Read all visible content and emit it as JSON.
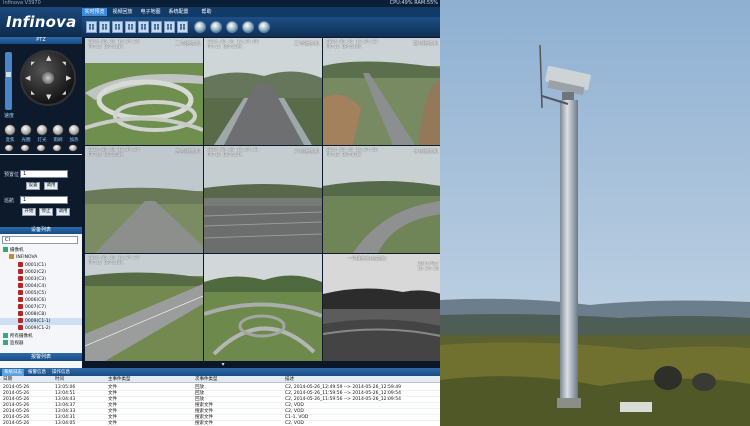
{
  "app": {
    "logo_text": "Infinova",
    "window_title": "Infinova V3970",
    "sysinfo": "CPU:49% RAM:55%",
    "menu_tabs": [
      "实时预览",
      "视频回放",
      "电子地图",
      "系统配置",
      "帮助"
    ],
    "ptz_title": "PTZ",
    "speed_label": "速度",
    "ptz_labels_row1": [
      "变焦",
      "光圈",
      "灯光",
      "雨刷",
      "加热"
    ],
    "ptz_labels_row2": [
      "聚焦",
      "",
      "",
      "",
      ""
    ],
    "preset_label": "预置位",
    "preset_value": "1",
    "preset_buttons": [
      "设置",
      "调用"
    ],
    "cruise_label": "巡航",
    "cruise_value": "1",
    "cruise_buttons": [
      "开始",
      "停止",
      "调用"
    ],
    "device_list_title": "设备列表",
    "device_combo": "CI",
    "device_tree": {
      "root": "摄像机",
      "nvr": "INFINOVA",
      "cameras": [
        "0001(C1)",
        "0002(C2)",
        "0003(C3)",
        "0004(C4)",
        "0005(C5)",
        "0006(C6)",
        "0007(C7)",
        "0008(C8)",
        "0009(C1-1)",
        "0009(C1-2)"
      ],
      "group1": "所有摄像机",
      "group2": "监视器"
    },
    "alarm_list_title": "报警列表"
  },
  "video": {
    "cells": [
      {
        "name": "二号摄像机",
        "time": "2014-05-26 16:34:22",
        "rate": "FR=15 BR=511K"
      },
      {
        "name": "三号摄像机",
        "time": "2014-05-26 16:34:08",
        "rate": "FR=15 BR=529K"
      },
      {
        "name": "四号摄像机",
        "time": "2014-05-26 16:34:23",
        "rate": "FR=15 BR=514K"
      },
      {
        "name": "五号摄像机",
        "time": "2014-05-26 16:34:24",
        "rate": "FR=15 BR=550K"
      },
      {
        "name": "六号摄像机",
        "time": "2014-05-26 16:34:11",
        "rate": "FR=15 BR=514K"
      },
      {
        "name": "七号摄像机",
        "time": "2014-05-26 16:34:26",
        "rate": "FR=15 BR=451K"
      },
      {
        "name": "",
        "time": "2014-05-26 16:34:22",
        "rate": "FR=15 BR=518K"
      },
      {
        "name": "",
        "time": "",
        "rate": ""
      },
      {
        "name": "一号摄像机(热成像)",
        "time": "2014/05/\n16:34:25",
        "rate": ""
      }
    ]
  },
  "log": {
    "tabs": [
      "系统日志",
      "报警信息",
      "操作信息"
    ],
    "headers": [
      "日期",
      "时间",
      "主事件类型",
      "次事件类型",
      "描述"
    ],
    "rows": [
      [
        "2014-05-26",
        "13:05:06",
        "文件",
        "回放",
        "C2, 2014-05-26_12:49:59 --> 2014-05-26_12:59:49"
      ],
      [
        "2014-05-26",
        "13:04:51",
        "文件",
        "回放",
        "C2, 2014-05-26_11:59:56 --> 2014-05-26_12:09:54"
      ],
      [
        "2014-05-26",
        "13:04:43",
        "文件",
        "回放",
        "C2, 2014-05-26_11:59:56 --> 2014-05-26_12:09:54"
      ],
      [
        "2014-05-26",
        "13:04:37",
        "文件",
        "搜索文件",
        "C2, VOD"
      ],
      [
        "2014-05-26",
        "13:04:33",
        "文件",
        "搜索文件",
        "C2, VOD"
      ],
      [
        "2014-05-26",
        "13:04:31",
        "文件",
        "搜索文件",
        "C1-1, VOD"
      ],
      [
        "2014-05-26",
        "13:04:05",
        "文件",
        "搜索文件",
        "C2, VOD"
      ]
    ]
  },
  "colors": {
    "panel_blue": "#174c84",
    "selected_cell_outline": "#3ad13a",
    "photo_sky": "#a9c3dd"
  }
}
